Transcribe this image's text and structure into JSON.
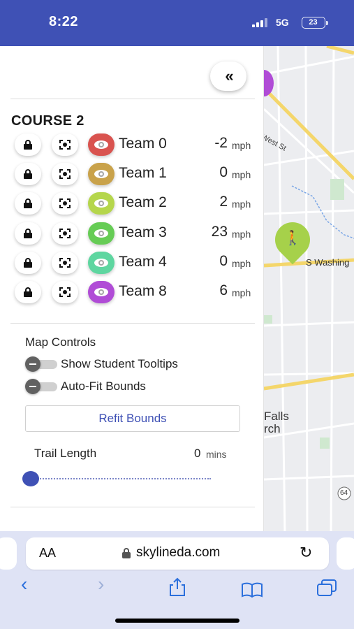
{
  "status_bar": {
    "time": "8:22",
    "network": "5G",
    "battery": "23"
  },
  "panel": {
    "collapse_label": "«",
    "course_title": "COURSE 2",
    "speed_unit": "mph",
    "teams": [
      {
        "name": "Team 0",
        "speed": "-2",
        "color": "#d9534f"
      },
      {
        "name": "Team 1",
        "speed": "0",
        "color": "#c9a24a"
      },
      {
        "name": "Team 2",
        "speed": "2",
        "color": "#b5d64c"
      },
      {
        "name": "Team 3",
        "speed": "23",
        "color": "#66cc55"
      },
      {
        "name": "Team 4",
        "speed": "0",
        "color": "#5ed6a0"
      },
      {
        "name": "Team 8",
        "speed": "6",
        "color": "#b04cd6"
      }
    ],
    "map_controls": {
      "title": "Map Controls",
      "toggles": [
        {
          "label": "Show Student Tooltips",
          "on": false
        },
        {
          "label": "Auto-Fit Bounds",
          "on": false
        }
      ],
      "refit_label": "Refit Bounds",
      "trail_label": "Trail Length",
      "trail_value": "0",
      "trail_unit": "mins"
    }
  },
  "map": {
    "labels": {
      "street1": "West St",
      "street2": "S Washing",
      "place1": "Falls",
      "place2": "rch",
      "route": "64"
    },
    "marker_color": "#a6d14a",
    "team_marker_color": "#b04cd6"
  },
  "browser": {
    "text_size_label": "AA",
    "url": "skylineda.com",
    "icons": [
      "back-icon",
      "forward-icon",
      "share-icon",
      "bookmarks-icon",
      "tabs-icon"
    ]
  }
}
